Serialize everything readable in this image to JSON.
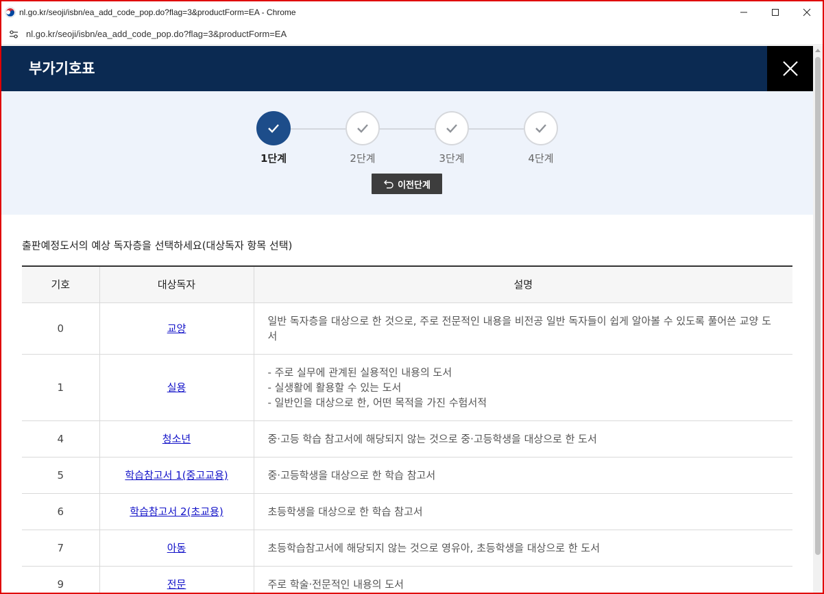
{
  "browser": {
    "title": "nl.go.kr/seoji/isbn/ea_add_code_pop.do?flag=3&productForm=EA - Chrome",
    "url": "nl.go.kr/seoji/isbn/ea_add_code_pop.do?flag=3&productForm=EA"
  },
  "modal": {
    "title": "부가기호표"
  },
  "steps": [
    {
      "label": "1단계",
      "state": "active"
    },
    {
      "label": "2단계",
      "state": "inactive"
    },
    {
      "label": "3단계",
      "state": "inactive"
    },
    {
      "label": "4단계",
      "state": "inactive"
    }
  ],
  "prev_button_label": "이전단계",
  "instruction": "출판예정도서의 예상 독자층을 선택하세요(대상독자 항목 선택)",
  "table": {
    "headers": [
      "기호",
      "대상독자",
      "설명"
    ],
    "rows": [
      {
        "code": "0",
        "reader": "교양",
        "desc": [
          "일반 독자층을 대상으로 한 것으로, 주로 전문적인 내용을 비전공 일반 독자들이 쉽게 알아볼 수 있도록 풀어쓴 교양 도서"
        ]
      },
      {
        "code": "1",
        "reader": "실용",
        "desc": [
          "- 주로 실무에 관계된 실용적인 내용의 도서",
          "- 실생활에 활용할 수 있는 도서",
          "- 일반인을 대상으로 한, 어떤 목적을 가진 수험서적"
        ]
      },
      {
        "code": "4",
        "reader": "청소년",
        "desc": [
          "중·고등 학습 참고서에 해당되지 않는 것으로 중·고등학생을 대상으로 한 도서"
        ]
      },
      {
        "code": "5",
        "reader": "학습참고서 1(중고교용)",
        "desc": [
          "중·고등학생을 대상으로 한 학습 참고서"
        ]
      },
      {
        "code": "6",
        "reader": "학습참고서 2(초교용)",
        "desc": [
          "초등학생을 대상으로 한 학습 참고서"
        ]
      },
      {
        "code": "7",
        "reader": "아동",
        "desc": [
          "초등학습참고서에 해당되지 않는 것으로 영유아, 초등학생을 대상으로 한 도서"
        ]
      },
      {
        "code": "9",
        "reader": "전문",
        "desc": [
          "주로 학술·전문적인 내용의 도서"
        ]
      }
    ]
  }
}
